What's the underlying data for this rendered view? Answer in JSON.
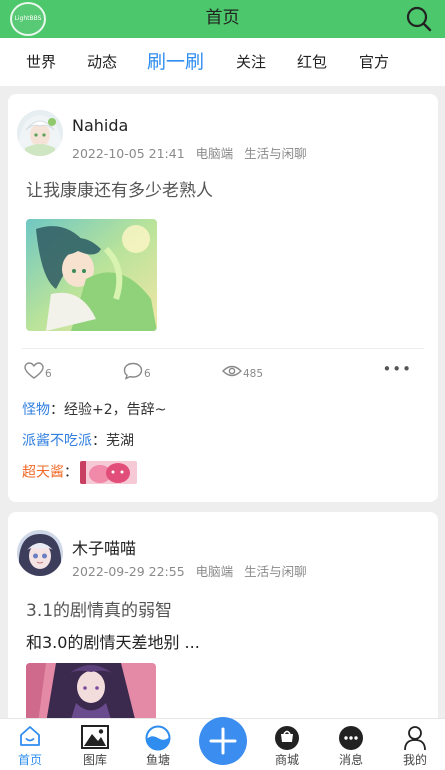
{
  "header": {
    "logo_text": "LightBBS",
    "title": "首页",
    "search_icon": "search-icon"
  },
  "tabs": [
    {
      "label": "世界",
      "active": false
    },
    {
      "label": "动态",
      "active": false
    },
    {
      "label": "刷一刷",
      "active": true
    },
    {
      "label": "关注",
      "active": false
    },
    {
      "label": "红包",
      "active": false
    },
    {
      "label": "官方",
      "active": false
    }
  ],
  "posts": [
    {
      "author": "Nahida",
      "time": "2022-10-05 21:41",
      "platform": "电脑端",
      "category": "生活与闲聊",
      "text": "让我康康还有多少老熟人",
      "likes": "6",
      "comments": "6",
      "views": "485",
      "more": "•••",
      "replies": [
        {
          "name": "怪物",
          "sep": "：",
          "text": "经验+2，告辞~"
        },
        {
          "name": "派酱不吃派",
          "sep": "：",
          "text": "芜湖"
        },
        {
          "name": "超天酱",
          "sep": "："
        }
      ]
    },
    {
      "author": "木子喵喵",
      "time": "2022-09-29 22:55",
      "platform": "电脑端",
      "category": "生活与闲聊",
      "text_line1": "3.1的剧情真的弱智",
      "text_line2": "和3.0的剧情天差地别 ..."
    }
  ],
  "bottom_nav": [
    {
      "label": "首页",
      "icon": "home-icon",
      "active": true
    },
    {
      "label": "图库",
      "icon": "gallery-icon",
      "active": false
    },
    {
      "label": "鱼塘",
      "icon": "pond-icon",
      "active": false
    },
    {
      "label": "",
      "icon": "plus-icon",
      "active": false
    },
    {
      "label": "商城",
      "icon": "shop-icon",
      "active": false
    },
    {
      "label": "消息",
      "icon": "message-icon",
      "active": false
    },
    {
      "label": "我的",
      "icon": "profile-icon",
      "active": false
    }
  ],
  "colors": {
    "header_bg": "#4cc76b",
    "accent_blue": "#2f8df0",
    "highlight_orange": "#f26b2a"
  }
}
